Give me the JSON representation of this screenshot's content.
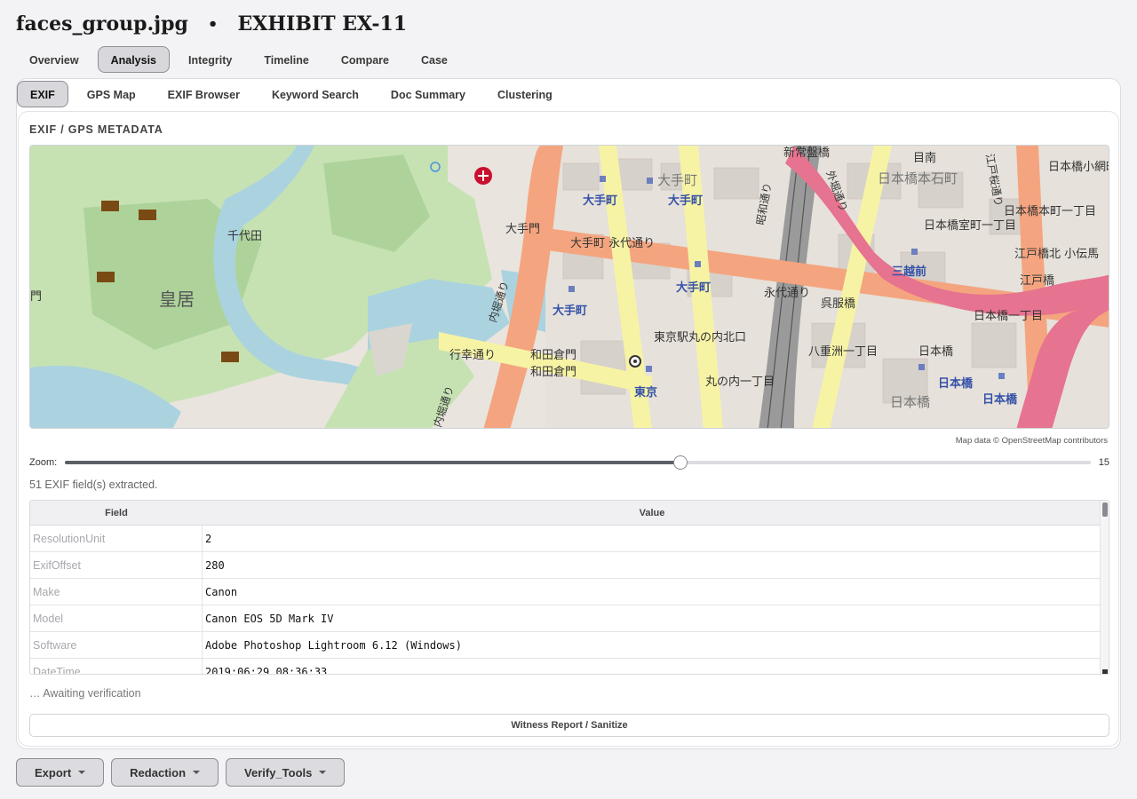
{
  "header": {
    "filename": "faces_group.jpg",
    "separator": "•",
    "exhibit": "EXHIBIT EX-11"
  },
  "main_tabs": [
    {
      "label": "Overview",
      "active": false
    },
    {
      "label": "Analysis",
      "active": true
    },
    {
      "label": "Integrity",
      "active": false
    },
    {
      "label": "Timeline",
      "active": false
    },
    {
      "label": "Compare",
      "active": false
    },
    {
      "label": "Case",
      "active": false
    }
  ],
  "sub_tabs": [
    {
      "label": "EXIF",
      "active": true
    },
    {
      "label": "GPS Map",
      "active": false
    },
    {
      "label": "EXIF Browser",
      "active": false
    },
    {
      "label": "Keyword Search",
      "active": false
    },
    {
      "label": "Doc Summary",
      "active": false
    },
    {
      "label": "Clustering",
      "active": false
    }
  ],
  "section_title": "EXIF / GPS METADATA",
  "map": {
    "attribution": "Map data © OpenStreetMap contributors",
    "labels": {
      "kokyo": "皇居",
      "chiyoda": "千代田",
      "otemon": "大手門",
      "otemachi1": "大手町",
      "otemachi2": "大手町",
      "otemachi3": "大手町",
      "otemachi4": "大手町",
      "otemachi5": "大手町",
      "otemachi_eitai": "大手町 永代通り",
      "eitai": "永代通り",
      "wadakura1": "和田倉門",
      "wadakura2": "和田倉門",
      "gyoko": "行幸通り",
      "uchibori1": "内堀通り",
      "uchibori2": "内堀通り",
      "marunouchi_kita": "東京駅丸の内北口",
      "tokyo": "東京",
      "marunouchi1": "丸の内一丁目",
      "yaesu1": "八重洲一丁目",
      "gofukubashi": "呉服橋",
      "nihonbashi1": "日本橋",
      "nihonbashi2": "日本橋",
      "nihonbashi3": "日本橋",
      "nihonbashi4": "日本橋",
      "mitsukoshimae": "三越前",
      "nihonbashi_hongoku": "日本橋本石町",
      "nihonbashi_muro": "日本橋室町一丁目",
      "nihonbashi_hon": "日本橋本町一丁目",
      "nihonbashi_1": "日本橋一丁目",
      "nihonbashi_koami": "日本橋小網町",
      "edobashi": "江戸橋",
      "mejiro": "目南",
      "shintokiwa": "新常盤橋",
      "sotobori": "外堀通り",
      "edosakura": "江戸桜通り",
      "showa": "昭和通り",
      "tokiwa_jct": "江戸橋北 小伝馬",
      "mon": "門"
    }
  },
  "zoom": {
    "label": "Zoom:",
    "value": "15",
    "fraction": 0.6
  },
  "fields_count": "51 EXIF field(s) extracted.",
  "table": {
    "headers": [
      "Field",
      "Value"
    ],
    "rows": [
      {
        "field": "ResolutionUnit",
        "value": "2"
      },
      {
        "field": "ExifOffset",
        "value": "280"
      },
      {
        "field": "Make",
        "value": "Canon"
      },
      {
        "field": "Model",
        "value": "Canon EOS 5D Mark IV"
      },
      {
        "field": "Software",
        "value": "Adobe Photoshop Lightroom 6.12 (Windows)"
      },
      {
        "field": "DateTime",
        "value": "2019:06:29 08:36:33"
      }
    ]
  },
  "status": "… Awaiting verification",
  "report_button": "Witness Report / Sanitize",
  "bottom_buttons": [
    {
      "label": "Export"
    },
    {
      "label": "Redaction"
    },
    {
      "label": "Verify_Tools"
    }
  ],
  "colors": {
    "accent_tab_bg": "#d8d8dc",
    "road_orange": "#f4a57f",
    "road_yellow": "#f7f3a5",
    "highway_pink": "#e6738f",
    "water": "#aad3df",
    "park": "#c8e6b4"
  }
}
